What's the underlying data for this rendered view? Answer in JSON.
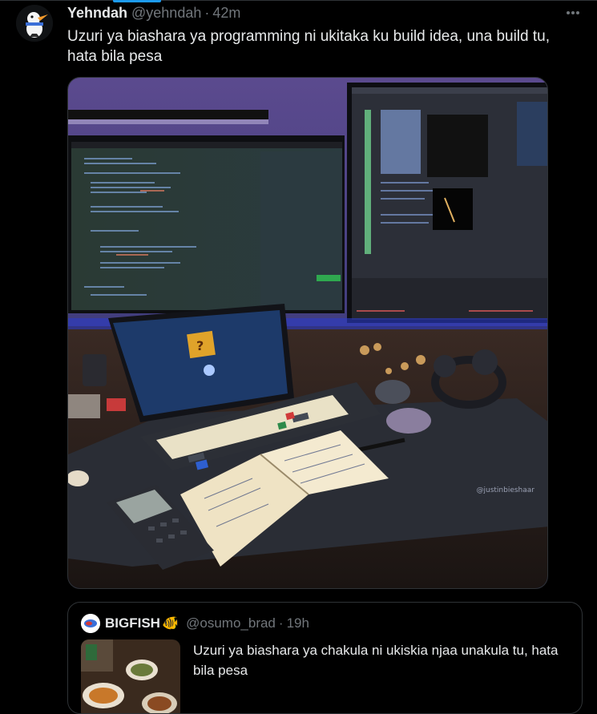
{
  "tweet": {
    "author_name": "Yehndah",
    "handle": "@yehndah",
    "separator": "·",
    "time": "42m",
    "text": "Uzuri ya biashara ya programming ni ukitaka ku build idea, una build tu, hata bila pesa",
    "more_icon": "more-horizontal-icon",
    "media": {
      "watermark": "@justinbieshaar"
    }
  },
  "quoted_tweet": {
    "author_name": "BIGFISH",
    "emoji": "🐠",
    "handle": "@osumo_brad",
    "separator": "·",
    "time": "19h",
    "text": "Uzuri ya biashara ya chakula ni ukiskia njaa unakula tu, hata bila pesa"
  },
  "colors": {
    "background": "#000000",
    "text_primary": "#e7e9ea",
    "text_secondary": "#71767b",
    "border": "#2f3336",
    "accent": "#1d9bf0"
  }
}
